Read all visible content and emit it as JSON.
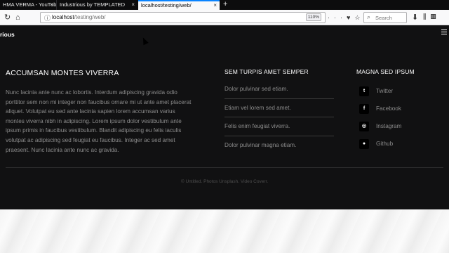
{
  "browser": {
    "tabs": [
      {
        "title": "HMA VERMA - YouTube"
      },
      {
        "title": "Industrious by TEMPLATED"
      },
      {
        "title": "localhost/testing/web/"
      }
    ],
    "close_glyph": "×",
    "newtab_glyph": "+",
    "back_glyph": "←",
    "forward_glyph": "↻",
    "home_glyph": "⌂",
    "url_prefix": "localhost",
    "url_path": "/testing/web/",
    "zoom": "110%",
    "search_placeholder": "Search",
    "toolbar_icons": [
      "library-icon",
      "sidebar-icon"
    ]
  },
  "site": {
    "logo": "rious"
  },
  "footer": {
    "col1": {
      "title": "ACCUMSAN MONTES VIVERRA",
      "text": "Nunc lacinia ante nunc ac lobortis. Interdum adipiscing gravida odio porttitor sem non mi integer non faucibus ornare mi ut ante amet placerat aliquet. Volutpat eu sed ante lacinia sapien lorem accumsan varius montes viverra nibh in adipiscing. Lorem ipsum dolor vestibulum ante ipsum primis in faucibus vestibulum. Blandit adipiscing eu felis iaculis volutpat ac adipiscing sed feugiat eu faucibus. Integer ac sed amet praesent. Nunc lacinia ante nunc ac gravida."
    },
    "col2": {
      "title": "SEM TURPIS AMET SEMPER",
      "links": [
        "Dolor pulvinar sed etiam.",
        "Etiam vel lorem sed amet.",
        "Felis enim feugiat viverra.",
        "Dolor pulvinar magna etiam."
      ]
    },
    "col3": {
      "title": "MAGNA SED IPSUM",
      "social": [
        {
          "label": "Twitter",
          "icon": "twitter-icon",
          "glyph": "t"
        },
        {
          "label": "Facebook",
          "icon": "facebook-icon",
          "glyph": "f"
        },
        {
          "label": "Instagram",
          "icon": "instagram-icon",
          "glyph": "◎"
        },
        {
          "label": "Github",
          "icon": "github-icon",
          "glyph": "●"
        }
      ]
    },
    "copyright": "© Untitled. Photos Unsplash. Video Coverr."
  },
  "colors": {
    "footer_bg": "#111112",
    "accent": "#0a84ff",
    "muted_text": "#8c8c8c"
  }
}
